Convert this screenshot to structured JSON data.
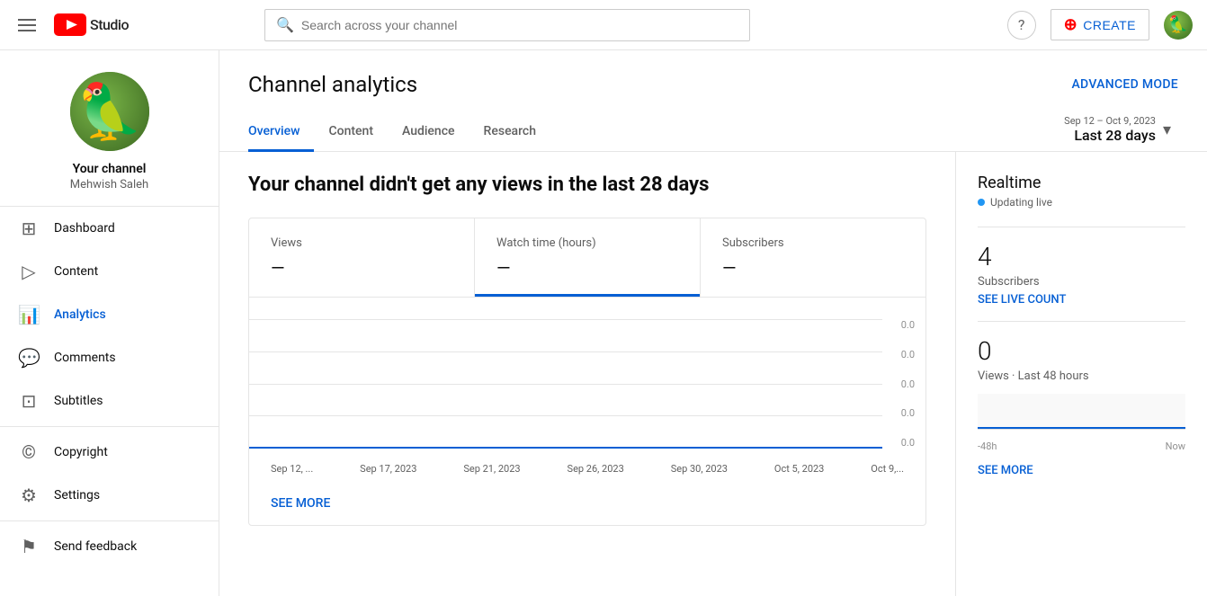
{
  "topnav": {
    "search_placeholder": "Search across your channel",
    "create_label": "CREATE",
    "help_icon": "help-circle-icon"
  },
  "sidebar": {
    "channel_name": "Your channel",
    "channel_handle": "Mehwish Saleh",
    "nav_items": [
      {
        "id": "dashboard",
        "label": "Dashboard",
        "icon": "⊞"
      },
      {
        "id": "content",
        "label": "Content",
        "icon": "▷"
      },
      {
        "id": "analytics",
        "label": "Analytics",
        "icon": "📊",
        "active": true
      },
      {
        "id": "comments",
        "label": "Comments",
        "icon": "💬"
      },
      {
        "id": "subtitles",
        "label": "Subtitles",
        "icon": "⊡"
      },
      {
        "id": "copyright",
        "label": "Copyright",
        "icon": "©"
      },
      {
        "id": "settings",
        "label": "Settings",
        "icon": "⚙"
      },
      {
        "id": "feedback",
        "label": "Send feedback",
        "icon": "⚑"
      }
    ]
  },
  "page": {
    "title": "Channel analytics",
    "advanced_mode_label": "ADVANCED MODE"
  },
  "tabs": [
    {
      "id": "overview",
      "label": "Overview",
      "active": true
    },
    {
      "id": "content",
      "label": "Content"
    },
    {
      "id": "audience",
      "label": "Audience"
    },
    {
      "id": "research",
      "label": "Research"
    }
  ],
  "date_range": {
    "period": "Sep 12 – Oct 9, 2023",
    "label": "Last 28 days"
  },
  "main_chart": {
    "no_views_message": "Your channel didn't get any views in the last 28 days",
    "metrics": [
      {
        "id": "views",
        "label": "Views",
        "value": "—"
      },
      {
        "id": "watch_time",
        "label": "Watch time (hours)",
        "value": "—",
        "active": true
      },
      {
        "id": "subscribers",
        "label": "Subscribers",
        "value": "—"
      }
    ],
    "y_labels": [
      "0.0",
      "0.0",
      "0.0",
      "0.0",
      "0.0"
    ],
    "x_labels": [
      "Sep 12, ...",
      "Sep 17, 2023",
      "Sep 21, 2023",
      "Sep 26, 2023",
      "Sep 30, 2023",
      "Oct 5, 2023",
      "Oct 9,..."
    ],
    "see_more_label": "SEE MORE"
  },
  "realtime": {
    "title": "Realtime",
    "updating_label": "Updating live",
    "subscribers_count": "4",
    "subscribers_label": "Subscribers",
    "see_live_count_label": "SEE LIVE COUNT",
    "views_count": "0",
    "views_label": "Views · Last 48 hours",
    "time_start": "-48h",
    "time_end": "Now",
    "see_more_label": "SEE MORE"
  }
}
